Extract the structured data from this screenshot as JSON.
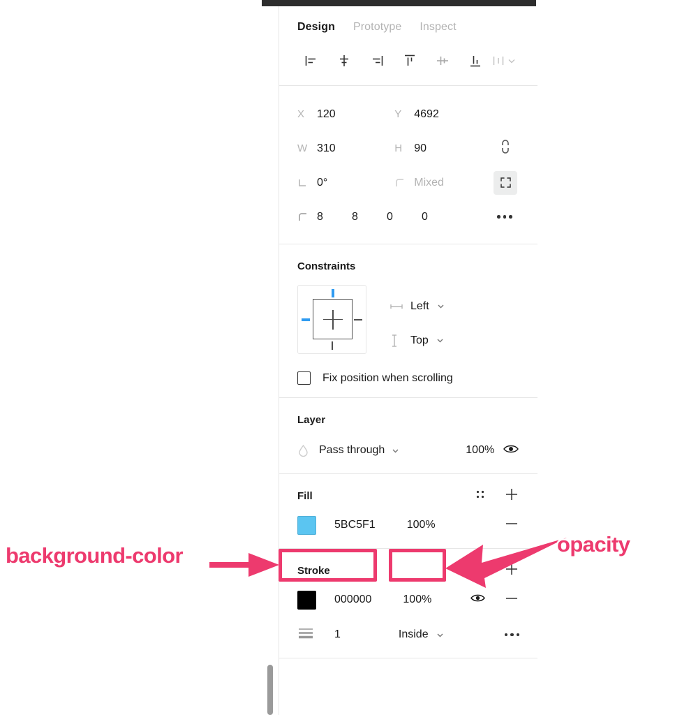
{
  "panel": {
    "tabs": [
      {
        "label": "Design",
        "active": true
      },
      {
        "label": "Prototype",
        "active": false
      },
      {
        "label": "Inspect",
        "active": false
      }
    ],
    "align_tools": [
      {
        "name": "align-left-icon"
      },
      {
        "name": "align-horizontal-center-icon"
      },
      {
        "name": "align-right-icon"
      },
      {
        "name": "align-top-icon"
      },
      {
        "name": "align-vertical-center-icon"
      },
      {
        "name": "align-bottom-icon"
      },
      {
        "name": "distribute-icon"
      }
    ],
    "properties": {
      "x_label": "X",
      "x_value": "120",
      "y_label": "Y",
      "y_value": "4692",
      "w_label": "W",
      "w_value": "310",
      "h_label": "H",
      "h_value": "90",
      "rotation_value": "0°",
      "corner_radius_value": "Mixed",
      "corners": [
        "8",
        "8",
        "0",
        "0"
      ]
    },
    "constraints": {
      "title": "Constraints",
      "horizontal": "Left",
      "vertical": "Top",
      "active_markers": [
        "top",
        "left"
      ],
      "fix_position_label": "Fix position when scrolling",
      "fix_position_checked": false
    },
    "layer": {
      "title": "Layer",
      "blend_mode": "Pass through",
      "opacity": "100%"
    },
    "fill": {
      "title": "Fill",
      "hex": "5BC5F1",
      "color": "#5BC5F1",
      "opacity": "100%"
    },
    "stroke": {
      "title": "Stroke",
      "hex": "000000",
      "color": "#000000",
      "opacity": "100%",
      "weight": "1",
      "align": "Inside"
    }
  },
  "annotations": {
    "accent_color": "#ED3A6E",
    "background_color_label": "background-color",
    "opacity_label": "opacity"
  }
}
